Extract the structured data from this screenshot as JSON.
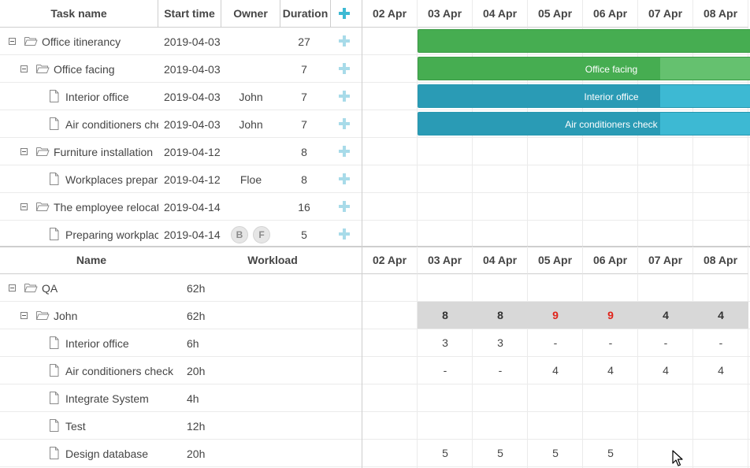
{
  "gantt": {
    "columns": {
      "task_name": "Task name",
      "start_time": "Start time",
      "owner": "Owner",
      "duration": "Duration"
    },
    "scale": [
      "02 Apr",
      "03 Apr",
      "04 Apr",
      "05 Apr",
      "06 Apr",
      "07 Apr",
      "08 Apr"
    ],
    "tasks": [
      {
        "name": "Office itinerancy",
        "start": "2019-04-03",
        "owner": "",
        "duration": "27",
        "type": "project",
        "level": 0,
        "expanded": true
      },
      {
        "name": "Office facing",
        "start": "2019-04-03",
        "owner": "",
        "duration": "7",
        "type": "project",
        "level": 1,
        "expanded": true
      },
      {
        "name": "Interior office",
        "start": "2019-04-03",
        "owner": "John",
        "duration": "7",
        "type": "task",
        "level": 2
      },
      {
        "name": "Air conditioners check",
        "start": "2019-04-03",
        "owner": "John",
        "duration": "7",
        "type": "task",
        "level": 2
      },
      {
        "name": "Furniture installation",
        "start": "2019-04-12",
        "owner": "",
        "duration": "8",
        "type": "project",
        "level": 1,
        "expanded": true
      },
      {
        "name": "Workplaces preparation",
        "start": "2019-04-12",
        "owner": "Floe",
        "duration": "8",
        "type": "task",
        "level": 2
      },
      {
        "name": "The employee relocation",
        "start": "2019-04-14",
        "owner": "",
        "duration": "16",
        "type": "project",
        "level": 1,
        "expanded": true
      },
      {
        "name": "Preparing workplaces",
        "start": "2019-04-14",
        "owner": "",
        "owner_badges": [
          "B",
          "F"
        ],
        "duration": "5",
        "type": "task",
        "level": 2
      }
    ],
    "bars": [
      {
        "row": 0,
        "label": "",
        "color": "#46ad51",
        "progress_pct": 100
      },
      {
        "row": 1,
        "label": "Office facing",
        "color": "#46ad51",
        "progress_pct": 70
      },
      {
        "row": 2,
        "label": "Interior office",
        "color": "#2a9bb5",
        "progress_pct": 70
      },
      {
        "row": 3,
        "label": "Air conditioners check",
        "color": "#2a9bb5",
        "progress_pct": 70
      }
    ]
  },
  "resources": {
    "columns": {
      "name": "Name",
      "workload": "Workload"
    },
    "scale": [
      "02 Apr",
      "03 Apr",
      "04 Apr",
      "05 Apr",
      "06 Apr",
      "07 Apr",
      "08 Apr"
    ],
    "rows": [
      {
        "name": "QA",
        "workload": "62h",
        "type": "folder",
        "level": 0,
        "cells": [
          "",
          "",
          "",
          "",
          "",
          "",
          ""
        ]
      },
      {
        "name": "John",
        "workload": "62h",
        "type": "folder",
        "level": 1,
        "summary": true,
        "cells": [
          "",
          "8",
          "8",
          "9",
          "9",
          "4",
          "4"
        ],
        "overload": [
          false,
          false,
          false,
          true,
          true,
          false,
          false
        ]
      },
      {
        "name": "Interior office",
        "workload": "6h",
        "type": "file",
        "level": 2,
        "cells": [
          "",
          "3",
          "3",
          "-",
          "-",
          "-",
          "-"
        ]
      },
      {
        "name": "Air conditioners check",
        "workload": "20h",
        "type": "file",
        "level": 2,
        "cells": [
          "",
          "-",
          "-",
          "4",
          "4",
          "4",
          "4"
        ]
      },
      {
        "name": "Integrate System",
        "workload": "4h",
        "type": "file",
        "level": 2,
        "cells": [
          "",
          "",
          "",
          "",
          "",
          "",
          ""
        ]
      },
      {
        "name": "Test",
        "workload": "12h",
        "type": "file",
        "level": 2,
        "cells": [
          "",
          "",
          "",
          "",
          "",
          "",
          ""
        ]
      },
      {
        "name": "Design database",
        "workload": "20h",
        "type": "file",
        "level": 2,
        "cells": [
          "",
          "5",
          "5",
          "5",
          "5",
          "",
          ""
        ]
      }
    ]
  },
  "colors": {
    "accent": "#3db9d3",
    "project_bar": "#46ad51",
    "task_bar": "#2a9bb5",
    "overload_text": "#e0231a",
    "summary_bg": "#d8d8d8"
  },
  "icons": {
    "folder": "folder-open-icon",
    "file": "file-icon",
    "add": "plus-icon",
    "toggle": "collapse-icon"
  }
}
